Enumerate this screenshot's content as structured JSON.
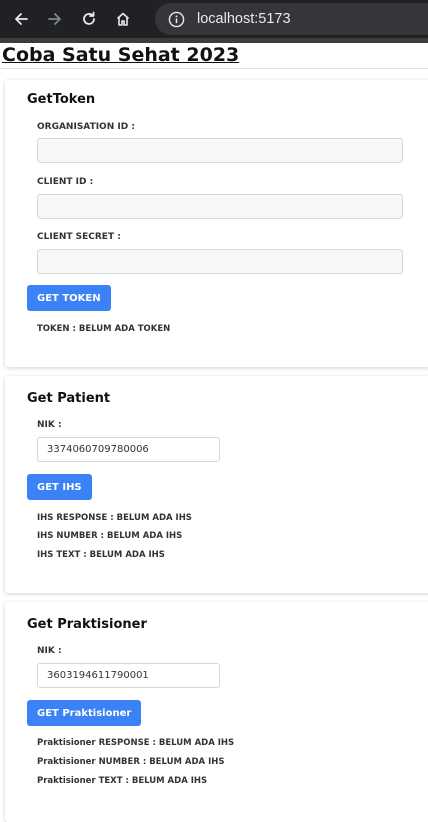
{
  "browser": {
    "url": "localhost:5173"
  },
  "page": {
    "title": "Coba Satu Sehat 2023"
  },
  "get_token": {
    "heading": "GetToken",
    "organisation_id_label": "ORGANISATION ID :",
    "organisation_id_value": "",
    "client_id_label": "CLIENT ID :",
    "client_id_value": "",
    "client_secret_label": "CLIENT SECRET :",
    "client_secret_value": "",
    "button_label": "GET TOKEN",
    "token_status": "TOKEN : BELUM ADA TOKEN"
  },
  "get_patient": {
    "heading": "Get Patient",
    "nik_label": "NIK :",
    "nik_value": "3374060709780006",
    "button_label": "GET IHS",
    "ihs_response": "IHS RESPONSE : BELUM ADA IHS",
    "ihs_number": "IHS NUMBER : BELUM ADA IHS",
    "ihs_text": "IHS TEXT : BELUM ADA IHS"
  },
  "get_praktisioner": {
    "heading": "Get Praktisioner",
    "nik_label": "NIK :",
    "nik_value": "3603194611790001",
    "button_label": "GET Praktisioner",
    "response": "Praktisioner RESPONSE : BELUM ADA IHS",
    "number": "Praktisioner NUMBER : BELUM ADA IHS",
    "text": "Praktisioner TEXT : BELUM ADA IHS"
  },
  "colors": {
    "primary_button": "#3b82f6",
    "chrome_bg": "#202124"
  }
}
